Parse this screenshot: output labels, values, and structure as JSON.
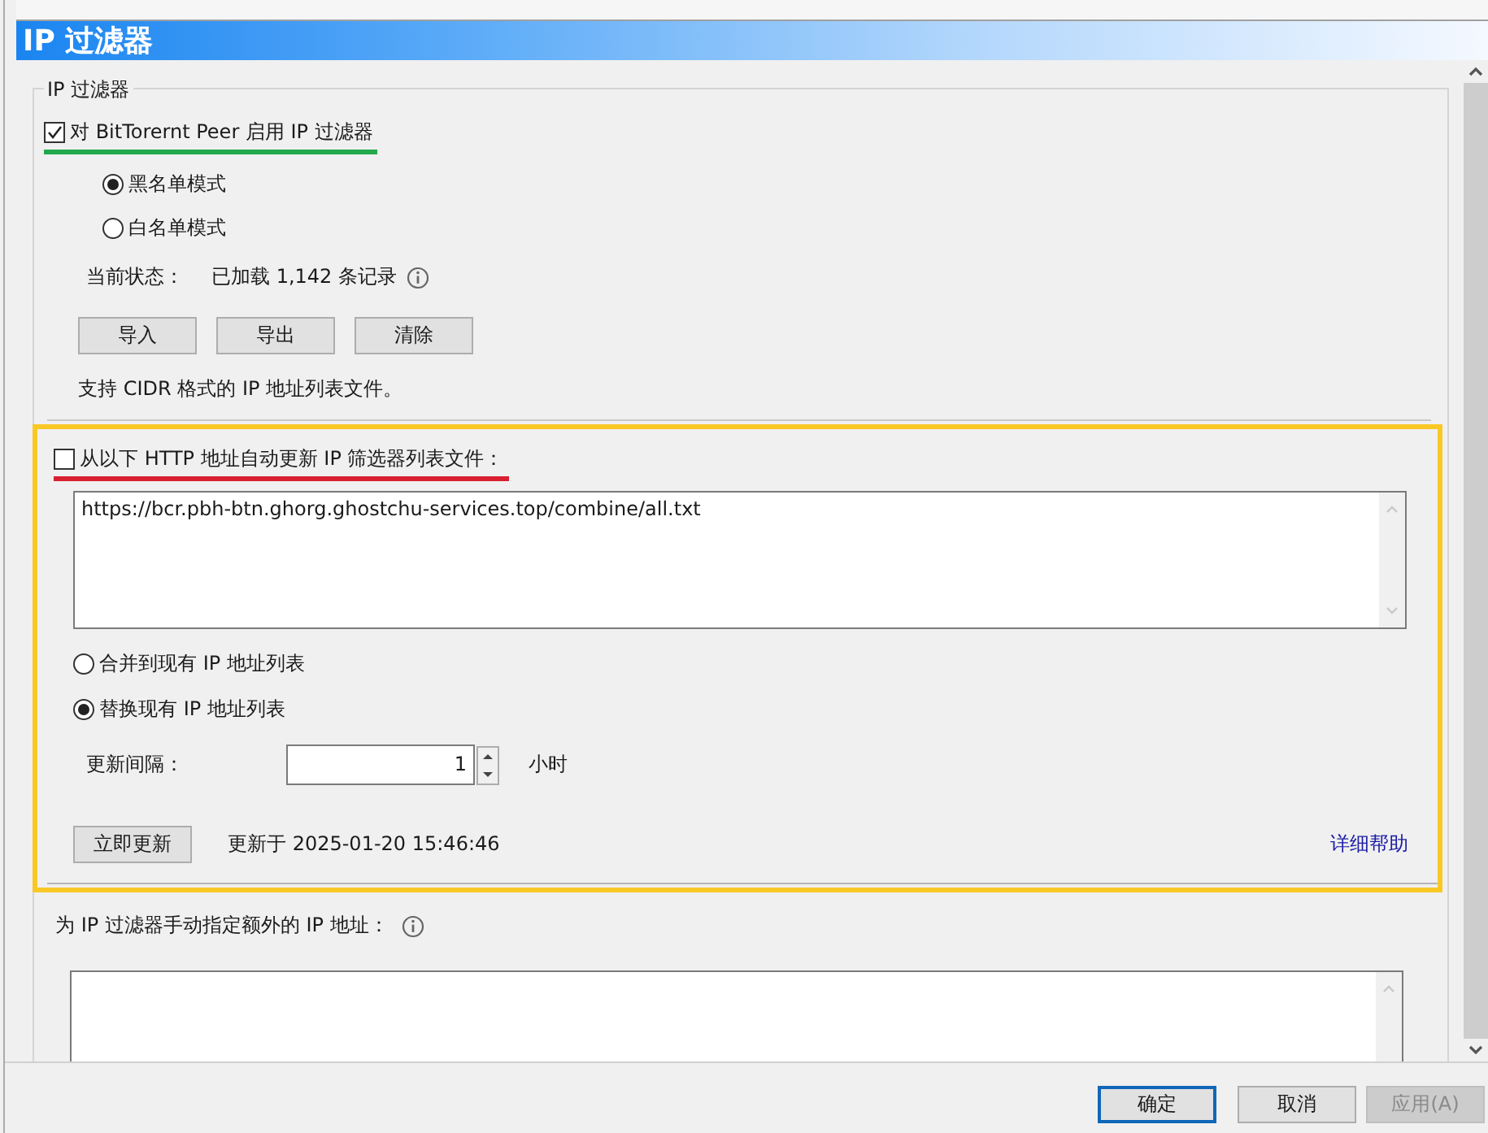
{
  "page_title": "IP 过滤器",
  "filter_group": {
    "legend": "IP 过滤器",
    "enable": {
      "label": "对 BitTorernt Peer 启用 IP 过滤器",
      "checked": true,
      "underlined": true
    },
    "modes": [
      {
        "label": "黑名单模式",
        "selected": true
      },
      {
        "label": "白名单模式",
        "selected": false
      }
    ],
    "status_label": "当前状态：",
    "status_value": "已加载 1,142 条记录",
    "buttons": [
      "导入",
      "导出",
      "清除"
    ],
    "note": "支持 CIDR 格式的 IP 地址列表文件。"
  },
  "auto_update": {
    "framed": true,
    "enable": {
      "label": "从以下 HTTP 地址自动更新 IP 筛选器列表文件：",
      "checked": false,
      "underlined": true
    },
    "urls": "https://bcr.pbh-btn.ghorg.ghostchu-services.top/combine/all.txt",
    "merge_modes": [
      {
        "label": "合并到现有 IP 地址列表",
        "selected": false
      },
      {
        "label": "替换现有 IP 地址列表",
        "selected": true
      }
    ],
    "interval_label": "更新间隔：",
    "interval_value": "1",
    "interval_unit": "小时",
    "update_button": "立即更新",
    "last_updated": "更新于 2025-01-20 15:46:46",
    "help_link": "详细帮助"
  },
  "manual": {
    "label": "为 IP 过滤器手动指定额外的 IP 地址："
  },
  "dialog_buttons": [
    {
      "label": "确定",
      "kind": "default",
      "disabled": false
    },
    {
      "label": "取消",
      "kind": "normal",
      "disabled": false
    },
    {
      "label": "应用(A)",
      "kind": "normal",
      "disabled": true
    }
  ]
}
